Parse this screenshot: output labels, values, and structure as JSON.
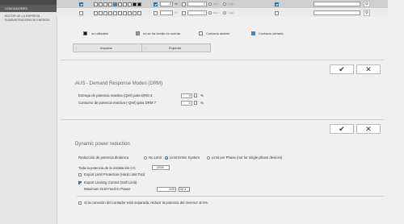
{
  "sidebar": {
    "active_item": "CONTADORES",
    "item": "EDITOR DE LA EMPRESA SUMINISTRADORA DE ENERGIA"
  },
  "table": {
    "row1": {
      "pct_value": "0",
      "pct_unit": "%",
      "value": "1",
      "ind": "Ind.",
      "cap": "Cap."
    },
    "row2": {
      "pct_value": "0",
      "pct_unit": "%",
      "value": "0",
      "ind": "Ind.",
      "cap": "Cap."
    }
  },
  "legend": {
    "not_usable": "no utilizable",
    "not_considered": "no se ha tenido en cuenta",
    "contact_open": "Contacto abierto",
    "contact_closed": "Contacto cerrado"
  },
  "io": {
    "import_label": "Importar",
    "export_label": "Exportar"
  },
  "aus": {
    "title": "AUS - Demand Response Modes (DRM)",
    "drm3_label": "Entrega de potencia reactiva (Qrel) para DRM 3",
    "drm3_value": "0",
    "drm3_unit": "%",
    "drm7_label": "Consumo de potencia reactiva (-Qrel) para DRM 7",
    "drm7_value": "0",
    "drm7_unit": "%"
  },
  "dpr": {
    "title": "Dynamic power reduction",
    "reduction_label": "Reducción de potencia dinámica",
    "opt_no_limit": "No Limit",
    "opt_entire": "Limit Entire System",
    "opt_phase": "Limit per Phase (not for single-phase devices)",
    "cc_label": "Toda la potencia de la instalación CC",
    "cc_value": "2500",
    "export_limit_protection": "Export Limit Protection (Hard Limit Trip)",
    "export_limiting_control": "Export Limiting Control (Soft Limit)",
    "max_grid_label": "Maximum Grid Feed-In Power",
    "max_grid_value": "100",
    "max_grid_unit": "W",
    "meter_disconnect": "Si la conexión del contador está separada, reducir la potencia del inversor al 0%."
  },
  "colors": {
    "accent": "#1f6fb2",
    "sidebar_dark": "#4a4a4a"
  }
}
